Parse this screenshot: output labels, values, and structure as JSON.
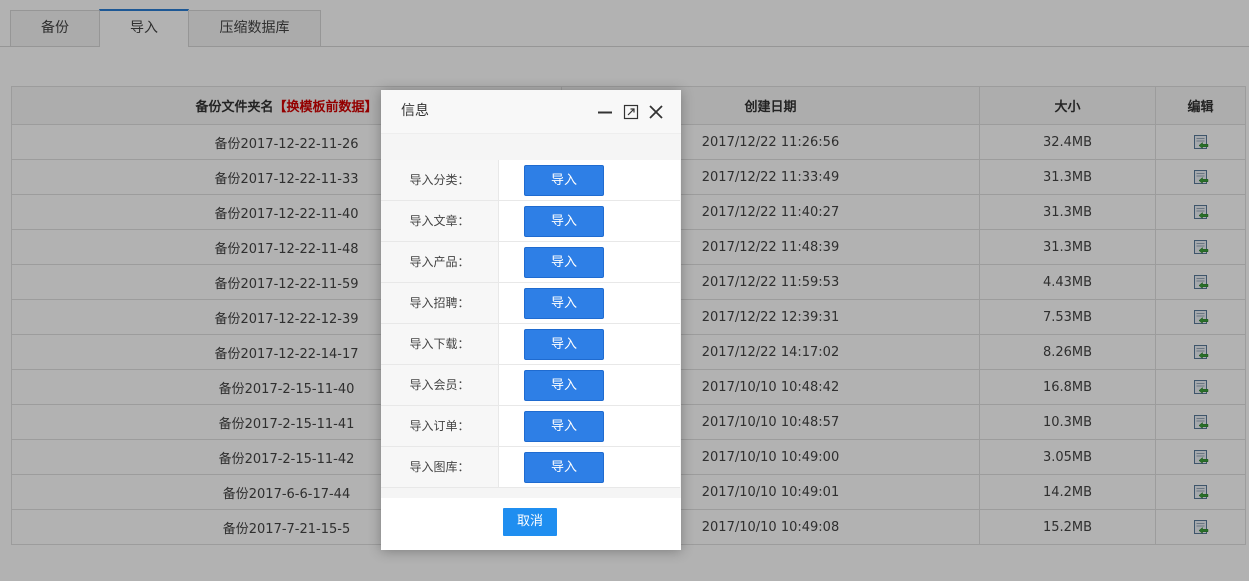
{
  "tabs": [
    {
      "label": "备份"
    },
    {
      "label": "导入"
    },
    {
      "label": "压缩数据库"
    }
  ],
  "table": {
    "headers": {
      "folder": "备份文件夹名",
      "folder_note": "【换模板前数据】",
      "date": "创建日期",
      "size": "大小",
      "edit": "编辑"
    },
    "rows": [
      {
        "folder": "备份2017-12-22-11-26",
        "date": "2017/12/22 11:26:56",
        "size": "32.4MB"
      },
      {
        "folder": "备份2017-12-22-11-33",
        "date": "2017/12/22 11:33:49",
        "size": "31.3MB"
      },
      {
        "folder": "备份2017-12-22-11-40",
        "date": "2017/12/22 11:40:27",
        "size": "31.3MB"
      },
      {
        "folder": "备份2017-12-22-11-48",
        "date": "2017/12/22 11:48:39",
        "size": "31.3MB"
      },
      {
        "folder": "备份2017-12-22-11-59",
        "date": "2017/12/22 11:59:53",
        "size": "4.43MB"
      },
      {
        "folder": "备份2017-12-22-12-39",
        "date": "2017/12/22 12:39:31",
        "size": "7.53MB"
      },
      {
        "folder": "备份2017-12-22-14-17",
        "date": "2017/12/22 14:17:02",
        "size": "8.26MB"
      },
      {
        "folder": "备份2017-2-15-11-40",
        "date": "2017/10/10 10:48:42",
        "size": "16.8MB"
      },
      {
        "folder": "备份2017-2-15-11-41",
        "date": "2017/10/10 10:48:57",
        "size": "10.3MB"
      },
      {
        "folder": "备份2017-2-15-11-42",
        "date": "2017/10/10 10:49:00",
        "size": "3.05MB"
      },
      {
        "folder": "备份2017-6-6-17-44",
        "date": "2017/10/10 10:49:01",
        "size": "14.2MB"
      },
      {
        "folder": "备份2017-7-21-15-5",
        "date": "2017/10/10 10:49:08",
        "size": "15.2MB"
      }
    ]
  },
  "dialog": {
    "title": "信息",
    "items": [
      {
        "label": "导入分类：",
        "button": "导入"
      },
      {
        "label": "导入文章：",
        "button": "导入"
      },
      {
        "label": "导入产品：",
        "button": "导入"
      },
      {
        "label": "导入招聘：",
        "button": "导入"
      },
      {
        "label": "导入下载：",
        "button": "导入"
      },
      {
        "label": "导入会员：",
        "button": "导入"
      },
      {
        "label": "导入订单：",
        "button": "导入"
      },
      {
        "label": "导入图库：",
        "button": "导入"
      }
    ],
    "cancel": "取消"
  },
  "colors": {
    "accent": "#2e7fe6",
    "note_red": "#d40000",
    "active_tab_border": "#2a7fd6"
  },
  "icons": {
    "edit": "restore-icon",
    "minimize": "minimize-icon",
    "maximize": "maximize-icon",
    "close": "close-icon"
  }
}
